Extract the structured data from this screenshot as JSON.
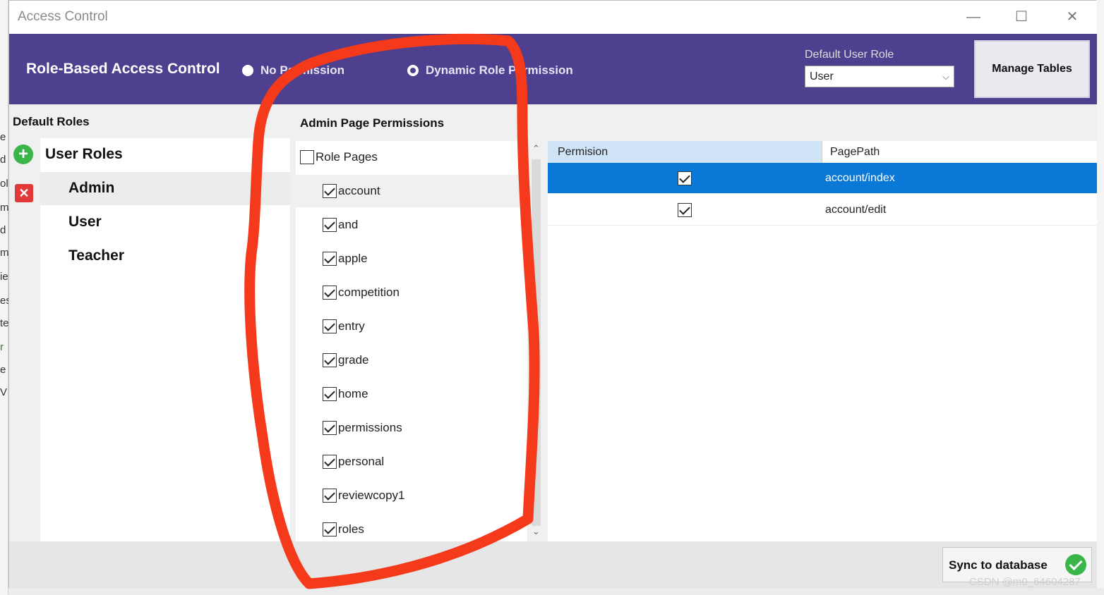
{
  "window": {
    "title": "Access Control",
    "controls": {
      "minimize": "—",
      "maximize": "☐",
      "close": "✕"
    }
  },
  "header": {
    "title": "Role-Based Access Control",
    "radio_no_permission": "No Permission",
    "radio_dynamic": "Dynamic Role Permission",
    "default_user_role_label": "Default User Role",
    "default_user_role_value": "User",
    "manage_tables_label": "Manage Tables"
  },
  "roles": {
    "heading": "Default Roles",
    "group_label": "User Roles",
    "items": [
      "Admin",
      "User",
      "Teacher"
    ]
  },
  "pages": {
    "heading": "Admin Page Permissions",
    "root_label": "Role Pages",
    "root_checked": false,
    "items": [
      {
        "label": "account",
        "checked": true
      },
      {
        "label": "and",
        "checked": true
      },
      {
        "label": "apple",
        "checked": true
      },
      {
        "label": "competition",
        "checked": true
      },
      {
        "label": "entry",
        "checked": true
      },
      {
        "label": "grade",
        "checked": true
      },
      {
        "label": "home",
        "checked": true
      },
      {
        "label": "permissions",
        "checked": true
      },
      {
        "label": "personal",
        "checked": true
      },
      {
        "label": "reviewcopy1",
        "checked": true
      },
      {
        "label": "roles",
        "checked": true
      }
    ]
  },
  "grid": {
    "columns": [
      "Permision",
      "PagePath"
    ],
    "rows": [
      {
        "permission": true,
        "path": "account/index",
        "selected": true
      },
      {
        "permission": true,
        "path": "account/edit",
        "selected": false
      }
    ]
  },
  "footer": {
    "sync_label": "Sync to database"
  },
  "watermark": "CSDN @m0_64604287",
  "colors": {
    "header_bg": "#4f3f8f",
    "selected_row": "#0a78d7",
    "annotation_stroke": "#f53a1c",
    "add_green": "#39b54a",
    "delete_red": "#e23a3a"
  },
  "background_fragments": [
    "e",
    "d",
    "ol",
    "m",
    "d",
    "m",
    "ie",
    "es",
    "te",
    "r",
    "e",
    "V"
  ]
}
